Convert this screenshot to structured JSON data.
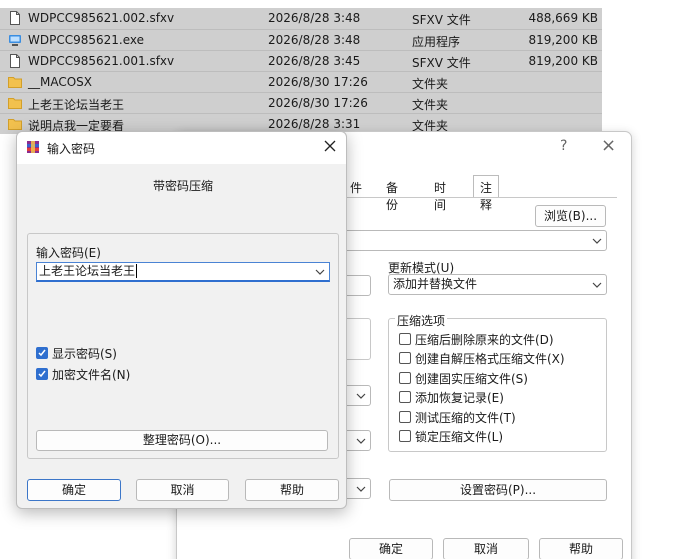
{
  "files": [
    {
      "name": "WDPCC985621.002.sfxv",
      "date": "2026/8/28 3:48",
      "type": "SFXV 文件",
      "size": "488,669 KB",
      "icon": "document-icon"
    },
    {
      "name": "WDPCC985621.exe",
      "date": "2026/8/28 3:48",
      "type": "应用程序",
      "size": "819,200 KB",
      "icon": "application-icon"
    },
    {
      "name": "WDPCC985621.001.sfxv",
      "date": "2026/8/28 3:45",
      "type": "SFXV 文件",
      "size": "819,200 KB",
      "icon": "document-icon"
    },
    {
      "name": "__MACOSX",
      "date": "2026/8/30 17:26",
      "type": "文件夹",
      "size": "",
      "icon": "folder-icon"
    },
    {
      "name": "上老王论坛当老王",
      "date": "2026/8/30 17:26",
      "type": "文件夹",
      "size": "",
      "icon": "folder-icon"
    },
    {
      "name": "说明点我一定要看",
      "date": "2026/8/28 3:31",
      "type": "文件夹",
      "size": "",
      "icon": "folder-icon"
    }
  ],
  "archive_dialog": {
    "help_glyph": "?",
    "close_glyph": "×",
    "tabs": [
      "件",
      "备份",
      "时间",
      "注释"
    ],
    "browse_button": "浏览(B)...",
    "update_mode_label": "更新模式(U)",
    "update_mode_value": "添加并替换文件",
    "options_group_label": "压缩选项",
    "options": [
      {
        "label": "压缩后删除原来的文件(D)",
        "checked": false
      },
      {
        "label": "创建自解压格式压缩文件(X)",
        "checked": false
      },
      {
        "label": "创建固实压缩文件(S)",
        "checked": false
      },
      {
        "label": "添加恢复记录(E)",
        "checked": false
      },
      {
        "label": "测试压缩的文件(T)",
        "checked": false
      },
      {
        "label": "锁定压缩文件(L)",
        "checked": false
      }
    ],
    "set_password_button": "设置密码(P)...",
    "ok_button": "确定",
    "cancel_button": "取消",
    "help_button": "帮助"
  },
  "password_dialog": {
    "title": "输入密码",
    "subtitle": "带密码压缩",
    "password_label": "输入密码(E)",
    "password_value": "上老王论坛当老王",
    "show_password_label": "显示密码(S)",
    "show_password_checked": true,
    "encrypt_names_label": "加密文件名(N)",
    "encrypt_names_checked": true,
    "organize_button": "整理密码(O)...",
    "ok_button": "确定",
    "cancel_button": "取消",
    "help_button": "帮助"
  },
  "colors": {
    "selection_row": "#cfcfcf",
    "accent": "#2f6fcf",
    "folder": "#f2c14e"
  }
}
